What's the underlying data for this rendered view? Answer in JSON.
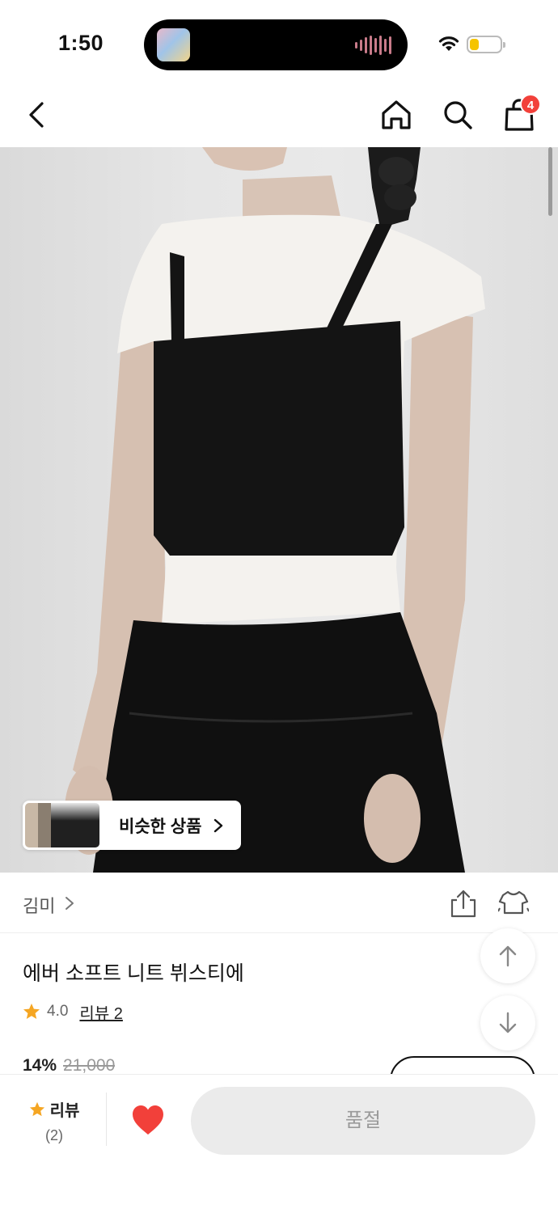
{
  "status_bar": {
    "time": "1:50",
    "battery_level": 0.3,
    "battery_color": "#f5c400"
  },
  "nav": {
    "back_icon": "chevron-left-icon",
    "home_icon": "home-icon",
    "search_icon": "search-icon",
    "cart_icon": "shopping-bag-icon",
    "cart_count": "4",
    "badge_color": "#f2403a"
  },
  "similar_products": {
    "label": "비슷한 상품",
    "arrow": "›"
  },
  "product": {
    "brand": "김미",
    "title": "에버 소프트 니트 뷔스티에",
    "rating": "4.0",
    "review_link": "리뷰 2",
    "discount": "14%",
    "original_price": "21,000",
    "star_color": "#f5a623"
  },
  "actions": {
    "share_icon": "share-icon",
    "tryon_icon": "clothing-icon",
    "scroll_up_icon": "arrow-up-icon",
    "scroll_down_icon": "arrow-down-icon"
  },
  "bottom_bar": {
    "review_label": "리뷰",
    "review_count": "(2)",
    "heart_color": "#f2403a",
    "soldout_label": "품절"
  }
}
